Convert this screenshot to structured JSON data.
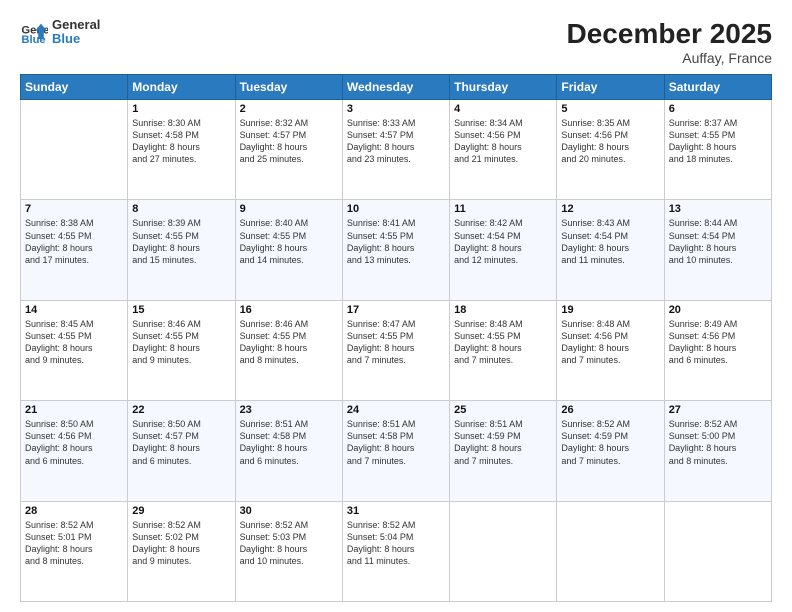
{
  "logo": {
    "line1": "General",
    "line2": "Blue"
  },
  "title": "December 2025",
  "subtitle": "Auffay, France",
  "weekdays": [
    "Sunday",
    "Monday",
    "Tuesday",
    "Wednesday",
    "Thursday",
    "Friday",
    "Saturday"
  ],
  "weeks": [
    [
      {
        "day": "",
        "info": ""
      },
      {
        "day": "1",
        "info": "Sunrise: 8:30 AM\nSunset: 4:58 PM\nDaylight: 8 hours\nand 27 minutes."
      },
      {
        "day": "2",
        "info": "Sunrise: 8:32 AM\nSunset: 4:57 PM\nDaylight: 8 hours\nand 25 minutes."
      },
      {
        "day": "3",
        "info": "Sunrise: 8:33 AM\nSunset: 4:57 PM\nDaylight: 8 hours\nand 23 minutes."
      },
      {
        "day": "4",
        "info": "Sunrise: 8:34 AM\nSunset: 4:56 PM\nDaylight: 8 hours\nand 21 minutes."
      },
      {
        "day": "5",
        "info": "Sunrise: 8:35 AM\nSunset: 4:56 PM\nDaylight: 8 hours\nand 20 minutes."
      },
      {
        "day": "6",
        "info": "Sunrise: 8:37 AM\nSunset: 4:55 PM\nDaylight: 8 hours\nand 18 minutes."
      }
    ],
    [
      {
        "day": "7",
        "info": "Sunrise: 8:38 AM\nSunset: 4:55 PM\nDaylight: 8 hours\nand 17 minutes."
      },
      {
        "day": "8",
        "info": "Sunrise: 8:39 AM\nSunset: 4:55 PM\nDaylight: 8 hours\nand 15 minutes."
      },
      {
        "day": "9",
        "info": "Sunrise: 8:40 AM\nSunset: 4:55 PM\nDaylight: 8 hours\nand 14 minutes."
      },
      {
        "day": "10",
        "info": "Sunrise: 8:41 AM\nSunset: 4:55 PM\nDaylight: 8 hours\nand 13 minutes."
      },
      {
        "day": "11",
        "info": "Sunrise: 8:42 AM\nSunset: 4:54 PM\nDaylight: 8 hours\nand 12 minutes."
      },
      {
        "day": "12",
        "info": "Sunrise: 8:43 AM\nSunset: 4:54 PM\nDaylight: 8 hours\nand 11 minutes."
      },
      {
        "day": "13",
        "info": "Sunrise: 8:44 AM\nSunset: 4:54 PM\nDaylight: 8 hours\nand 10 minutes."
      }
    ],
    [
      {
        "day": "14",
        "info": "Sunrise: 8:45 AM\nSunset: 4:55 PM\nDaylight: 8 hours\nand 9 minutes."
      },
      {
        "day": "15",
        "info": "Sunrise: 8:46 AM\nSunset: 4:55 PM\nDaylight: 8 hours\nand 9 minutes."
      },
      {
        "day": "16",
        "info": "Sunrise: 8:46 AM\nSunset: 4:55 PM\nDaylight: 8 hours\nand 8 minutes."
      },
      {
        "day": "17",
        "info": "Sunrise: 8:47 AM\nSunset: 4:55 PM\nDaylight: 8 hours\nand 7 minutes."
      },
      {
        "day": "18",
        "info": "Sunrise: 8:48 AM\nSunset: 4:55 PM\nDaylight: 8 hours\nand 7 minutes."
      },
      {
        "day": "19",
        "info": "Sunrise: 8:48 AM\nSunset: 4:56 PM\nDaylight: 8 hours\nand 7 minutes."
      },
      {
        "day": "20",
        "info": "Sunrise: 8:49 AM\nSunset: 4:56 PM\nDaylight: 8 hours\nand 6 minutes."
      }
    ],
    [
      {
        "day": "21",
        "info": "Sunrise: 8:50 AM\nSunset: 4:56 PM\nDaylight: 8 hours\nand 6 minutes."
      },
      {
        "day": "22",
        "info": "Sunrise: 8:50 AM\nSunset: 4:57 PM\nDaylight: 8 hours\nand 6 minutes."
      },
      {
        "day": "23",
        "info": "Sunrise: 8:51 AM\nSunset: 4:58 PM\nDaylight: 8 hours\nand 6 minutes."
      },
      {
        "day": "24",
        "info": "Sunrise: 8:51 AM\nSunset: 4:58 PM\nDaylight: 8 hours\nand 7 minutes."
      },
      {
        "day": "25",
        "info": "Sunrise: 8:51 AM\nSunset: 4:59 PM\nDaylight: 8 hours\nand 7 minutes."
      },
      {
        "day": "26",
        "info": "Sunrise: 8:52 AM\nSunset: 4:59 PM\nDaylight: 8 hours\nand 7 minutes."
      },
      {
        "day": "27",
        "info": "Sunrise: 8:52 AM\nSunset: 5:00 PM\nDaylight: 8 hours\nand 8 minutes."
      }
    ],
    [
      {
        "day": "28",
        "info": "Sunrise: 8:52 AM\nSunset: 5:01 PM\nDaylight: 8 hours\nand 8 minutes."
      },
      {
        "day": "29",
        "info": "Sunrise: 8:52 AM\nSunset: 5:02 PM\nDaylight: 8 hours\nand 9 minutes."
      },
      {
        "day": "30",
        "info": "Sunrise: 8:52 AM\nSunset: 5:03 PM\nDaylight: 8 hours\nand 10 minutes."
      },
      {
        "day": "31",
        "info": "Sunrise: 8:52 AM\nSunset: 5:04 PM\nDaylight: 8 hours\nand 11 minutes."
      },
      {
        "day": "",
        "info": ""
      },
      {
        "day": "",
        "info": ""
      },
      {
        "day": "",
        "info": ""
      }
    ]
  ]
}
